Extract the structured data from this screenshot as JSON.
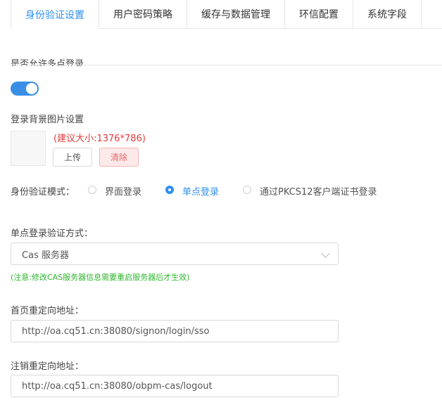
{
  "tabs": [
    {
      "label": "身份验证设置",
      "active": true
    },
    {
      "label": "用户密码策略",
      "active": false
    },
    {
      "label": "缓存与数据管理",
      "active": false
    },
    {
      "label": "环信配置",
      "active": false
    },
    {
      "label": "系统字段",
      "active": false
    }
  ],
  "multi_login": {
    "label": "是否允许多点登录",
    "enabled": true
  },
  "background_image": {
    "label": "登录背景图片设置",
    "size_hint": "(建议大小:1376*786)",
    "upload_label": "上传",
    "clear_label": "清除"
  },
  "auth_mode": {
    "label": "身份验证模式：",
    "options": [
      "界面登录",
      "单点登录",
      "通过PKCS12客户端证书登录"
    ],
    "selected": "单点登录"
  },
  "sso_method": {
    "label": "单点登录验证方式：",
    "value": "Cas 服务器",
    "note": "(注意:修改CAS服务器信息需要重启服务器后才生效)"
  },
  "home_redirect": {
    "label": "首页重定向地址：",
    "value": "http://oa.cq51.cn:38080/signon/login/sso"
  },
  "logout_redirect": {
    "label": "注销重定向地址：",
    "value": "http://oa.cq51.cn:38080/obpm-cas/logout"
  },
  "colors": {
    "accent": "#2f8ff0",
    "warning_text": "#e23c3c",
    "note_text": "#2db52d"
  }
}
